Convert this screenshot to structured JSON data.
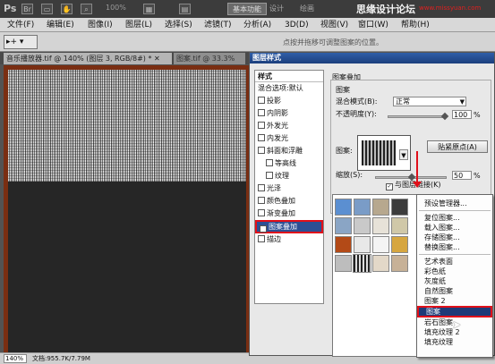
{
  "app": {
    "logo": "Ps",
    "zoom": "100%",
    "workspace_buttons": [
      "基本功能",
      "设计",
      "绘画"
    ],
    "watermark": "思缘设计论坛",
    "watermark_url": "www.missyuan.com"
  },
  "menu": [
    "文件(F)",
    "编辑(E)",
    "图像(I)",
    "图层(L)",
    "选择(S)",
    "滤镜(T)",
    "分析(A)",
    "3D(D)",
    "视图(V)",
    "窗口(W)",
    "帮助(H)"
  ],
  "options_bar": {
    "tool_label": "▸+ ▾",
    "hint": "点按并拖移可调整图案的位置。"
  },
  "tabs": [
    {
      "label": "音乐播放器.tif @ 140% (图层 3, RGB/8#) *  ✕"
    },
    {
      "label": "图案.tif @ 33.3% (图层"
    }
  ],
  "status": {
    "zoom": "140%",
    "doc": "文档:955.7K/7.79M"
  },
  "dialog": {
    "title": "图层样式",
    "styles_header": "样式",
    "styles": [
      {
        "label": "混合选项:默认",
        "checkbox": false
      },
      {
        "label": "投影",
        "checkbox": true,
        "checked": false
      },
      {
        "label": "内阴影",
        "checkbox": true,
        "checked": false
      },
      {
        "label": "外发光",
        "checkbox": true,
        "checked": false
      },
      {
        "label": "内发光",
        "checkbox": true,
        "checked": false
      },
      {
        "label": "斜面和浮雕",
        "checkbox": true,
        "checked": false
      },
      {
        "label": "等高线",
        "checkbox": true,
        "checked": false,
        "indent": true
      },
      {
        "label": "纹理",
        "checkbox": true,
        "checked": false,
        "indent": true
      },
      {
        "label": "光泽",
        "checkbox": true,
        "checked": false
      },
      {
        "label": "颜色叠加",
        "checkbox": true,
        "checked": false
      },
      {
        "label": "渐变叠加",
        "checkbox": true,
        "checked": false
      },
      {
        "label": "图案叠加",
        "checkbox": true,
        "checked": true,
        "selected": true
      },
      {
        "label": "描边",
        "checkbox": true,
        "checked": false
      }
    ],
    "group_title": "图案叠加",
    "sub_title": "图案",
    "blend_mode_label": "混合模式(B):",
    "blend_mode_value": "正常",
    "opacity_label": "不透明度(Y):",
    "opacity_value": "100",
    "opacity_unit": "%",
    "pattern_label": "图案:",
    "snap_button": "贴紧原点(A)",
    "scale_label": "缩放(S):",
    "scale_value": "50",
    "scale_unit": "%",
    "link_label": "与图层链接(K)",
    "link_checked": true
  },
  "picker_colors": [
    [
      "#5b8fd1",
      "#7a9cc7",
      "#b7a88e",
      "#3c3c3c"
    ],
    [
      "#8aa5c5",
      "#c9c9c9",
      "#e7e2d8",
      "#d0c8a8"
    ],
    [
      "#b34a17",
      "#e8e8e8",
      "#f4f4f4",
      "#d6a640"
    ],
    [
      "#bdbdbd",
      "#efefef",
      "#e3d8c8",
      "#c7b197"
    ]
  ],
  "context_menu": {
    "items": [
      "预设管理器...",
      "-",
      "复位图案...",
      "载入图案...",
      "存储图案...",
      "替换图案...",
      "-",
      "艺术表面",
      "彩色纸",
      "灰度纸",
      "自然图案",
      "图案 2",
      "图案",
      "岩石图案",
      "填充纹理 2",
      "填充纹理"
    ],
    "selected_index": 12
  }
}
